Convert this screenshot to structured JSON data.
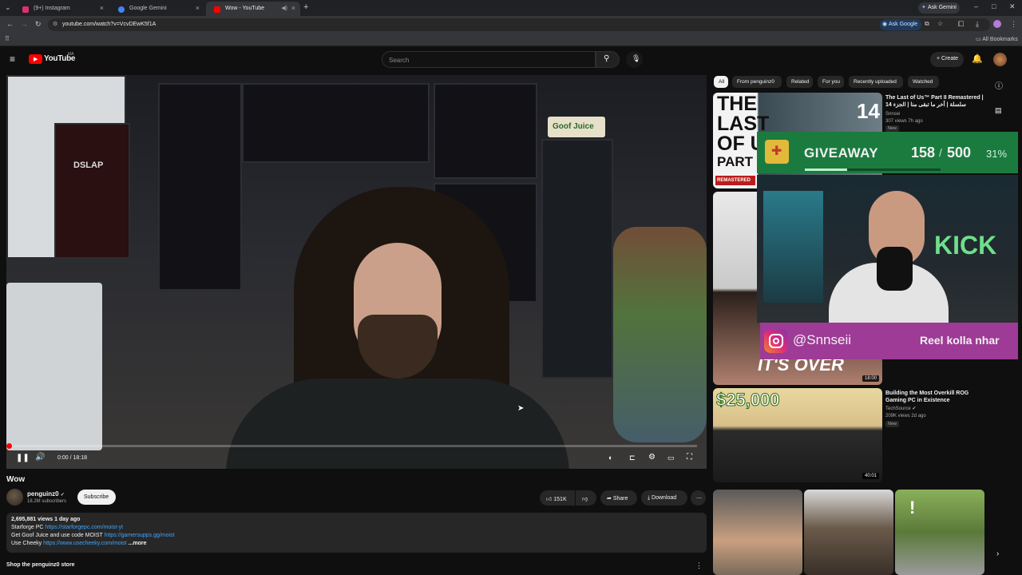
{
  "browser": {
    "tabs": [
      {
        "label": "(9+) Instagram"
      },
      {
        "label": "Google Gemini"
      },
      {
        "label": "Wow - YouTube"
      }
    ],
    "ask_gemini": "Ask Gemini",
    "url": "youtube.com/watch?v=VcvDEwK5f1A",
    "ask_google": "Ask Google",
    "all_bookmarks": "All Bookmarks"
  },
  "youtube": {
    "logo": "YouTube",
    "region": "MA",
    "search_placeholder": "Search",
    "create_label": "Create"
  },
  "player": {
    "time": "0:00 / 18:18",
    "progress": 0.0,
    "sign_text": "Goof Juice",
    "poster_text": "DSLAP"
  },
  "video": {
    "title": "Wow",
    "channel": "penguinz0",
    "subscribers": "18.2M subscribers",
    "subscribe_label": "Subscribe",
    "likes": "151K",
    "share_label": "Share",
    "download_label": "Download",
    "views_line": "2,695,881 views  1 day ago",
    "desc_lines": [
      {
        "text": "Starforge PC ",
        "link": "https://starforgepc.com/moist-yt"
      },
      {
        "text": "Get Goof Juice and use code MOIST ",
        "link": "https://gamersupps.gg/moist"
      },
      {
        "text": "Use Cheeky ",
        "link": "https://www.usecheeky.com/moist"
      }
    ],
    "more_label": "...more",
    "store_label": "Shop the penguinz0 store"
  },
  "chips": [
    "All",
    "From penguinz0",
    "Related",
    "For you",
    "Recently uploaded",
    "Watched"
  ],
  "recommendations": [
    {
      "title": "The Last of Us™ Part II Remastered | 14 سلسلة | أخر ما تبقى منا | الجزء",
      "channel": "Snnsei",
      "meta": "307 views  7h ago",
      "badge": "New",
      "thumb_text": [
        "THE",
        "LAST",
        "OF US",
        "PART II"
      ],
      "thumb_sub": "REMASTERED",
      "thumb_num": "14"
    },
    {
      "title": "",
      "channel": "",
      "meta": "",
      "duration": "18:00",
      "thumb_text": "IT'S OVER"
    },
    {
      "title": "Building the Most Overkill ROG Gaming PC in Existence",
      "channel": "TechSource",
      "meta": "209K views  2d ago",
      "badge": "New",
      "duration": "40:01",
      "thumb_text": "$25,000"
    }
  ],
  "overlay": {
    "giveaway_label": "GIVEAWAY",
    "count": "158",
    "total": "500",
    "percent": "31%",
    "progress": 0.31,
    "handle": "@Snnseii",
    "caption": "Reel kolla nhar",
    "neon_text": "KICK"
  },
  "colors": {
    "yt_red": "#ff0000",
    "link_blue": "#3ea6ff",
    "giveaway_green": "#1b7b3f",
    "instagram_bar": "#9e3b96"
  }
}
